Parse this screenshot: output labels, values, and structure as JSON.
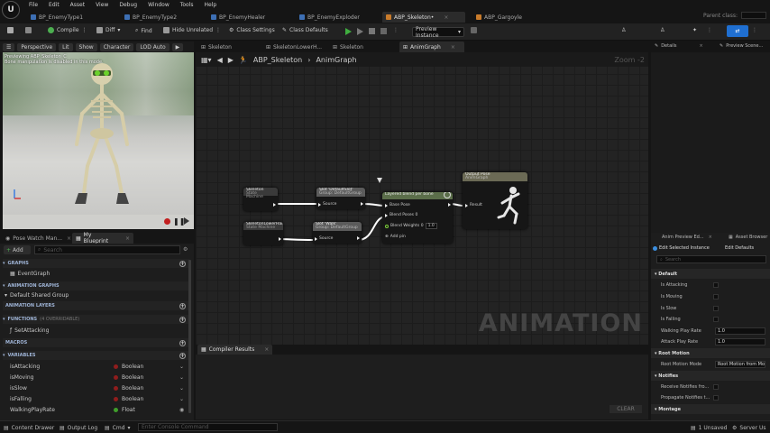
{
  "menubar": {
    "items": [
      "File",
      "Edit",
      "Asset",
      "View",
      "Debug",
      "Window",
      "Tools",
      "Help"
    ]
  },
  "tabs": [
    "BP_EnemyType1",
    "BP_EnemyType2",
    "BP_EnemyHealer",
    "BP_EnemyExploder",
    "ABP_Skeleton•",
    "ABP_Gargoyle"
  ],
  "parent_class_label": "Parent class:",
  "toolbar": {
    "compile": "Compile",
    "find": "Find",
    "hide_unrelated": "Hide Unrelated",
    "class_settings": "Class Settings",
    "class_defaults": "Class Defaults",
    "diff": "Diff",
    "preview_instance": "Preview Instance"
  },
  "viewport": {
    "perspective": "Perspective",
    "lit": "Lit",
    "show": "Show",
    "character": "Character",
    "lod": "LOD Auto",
    "caption_line1": "Previewing ABP_Skeleton_C",
    "caption_line2": "Bone manipulation is disabled in this mode."
  },
  "left_tabs": {
    "pose_watch": "Pose Watch Man...",
    "my_blueprint": "My Blueprint"
  },
  "my_blueprint": {
    "add": "Add",
    "search_placeholder": "Search",
    "graphs": "GRAPHS",
    "event_graph": "EventGraph",
    "animation_graphs": "ANIMATION GRAPHS",
    "default_shared": "Default Shared Group",
    "animation_layers": "ANIMATION LAYERS",
    "functions": "FUNCTIONS",
    "functions_note": "(4 OVERRIDABLE)",
    "set_attacking": "SetAttacking",
    "macros": "MACROS",
    "variables": "VARIABLES",
    "variables_list": [
      {
        "name": "isAttacking",
        "type": "Boolean",
        "color": "#8f1d1d"
      },
      {
        "name": "isMoving",
        "type": "Boolean",
        "color": "#8f1d1d"
      },
      {
        "name": "isSlow",
        "type": "Boolean",
        "color": "#8f1d1d"
      },
      {
        "name": "isFalling",
        "type": "Boolean",
        "color": "#8f1d1d"
      },
      {
        "name": "WalkingPlayRate",
        "type": "Float",
        "color": "#3f9e2b"
      }
    ]
  },
  "graph_tabs": [
    "Skeleton",
    "SkeletonLowerH...",
    "Skeleton",
    "AnimGraph"
  ],
  "graph": {
    "crumb_root": "ABP_Skeleton",
    "crumb_sep": "›",
    "crumb_leaf": "AnimGraph",
    "zoom": "Zoom -2",
    "watermark": "ANIMATION",
    "nodes": {
      "skeleton": {
        "title": "Skeleton",
        "sub": "State Machine"
      },
      "skeleton_lower": {
        "title": "SkeletonLowerHalf",
        "sub": "State Machine"
      },
      "slot_upper": {
        "title": "Slot 'DefaultSlot'",
        "sub": "Group: DefaultGroup",
        "pin": "Source"
      },
      "slot_walk": {
        "title": "Slot 'Walk'",
        "sub": "Group: DefaultGroup",
        "pin": "Source"
      },
      "layered": {
        "title": "Layered blend per bone",
        "base": "Base Pose",
        "blend": "Blend Poses 0",
        "weight": "Blend Weights 0",
        "weight_val": "1.0",
        "add": "Add pin"
      },
      "output": {
        "title": "Output Pose",
        "sub": "AnimGraph",
        "pin": "Result"
      }
    }
  },
  "results": {
    "tab": "Compiler Results",
    "clear": "CLEAR"
  },
  "right": {
    "details": "Details",
    "preview_scene": "Preview Scene...",
    "anim_preview": "Anim Preview Ed...",
    "asset_browser": "Asset Browser",
    "edit_selected": "Edit Selected Instance",
    "edit_defaults": "Edit Defaults",
    "search_placeholder": "Search",
    "default_cat": "Default",
    "props": [
      {
        "name": "Is Attacking"
      },
      {
        "name": "Is Moving"
      },
      {
        "name": "Is Slow"
      },
      {
        "name": "Is Falling"
      }
    ],
    "walking_play_rate": {
      "name": "Walking Play Rate",
      "value": "1.0"
    },
    "attack_play_rate": {
      "name": "Attack Play Rate",
      "value": "1.0"
    },
    "root_motion_cat": "Root Motion",
    "root_motion_mode": {
      "name": "Root Motion Mode",
      "value": "Root Motion from Montag"
    },
    "notifies_cat": "Notifies",
    "receive_notifies": "Receive Notifies fro...",
    "propagate_notifies": "Propagate Notifies t...",
    "montage_cat": "Montage"
  },
  "statusbar": {
    "content_drawer": "Content Drawer",
    "output_log": "Output Log",
    "cmd": "Cmd",
    "console_placeholder": "Enter Console Command",
    "unsaved": "1 Unsaved",
    "server": "Server Us"
  }
}
